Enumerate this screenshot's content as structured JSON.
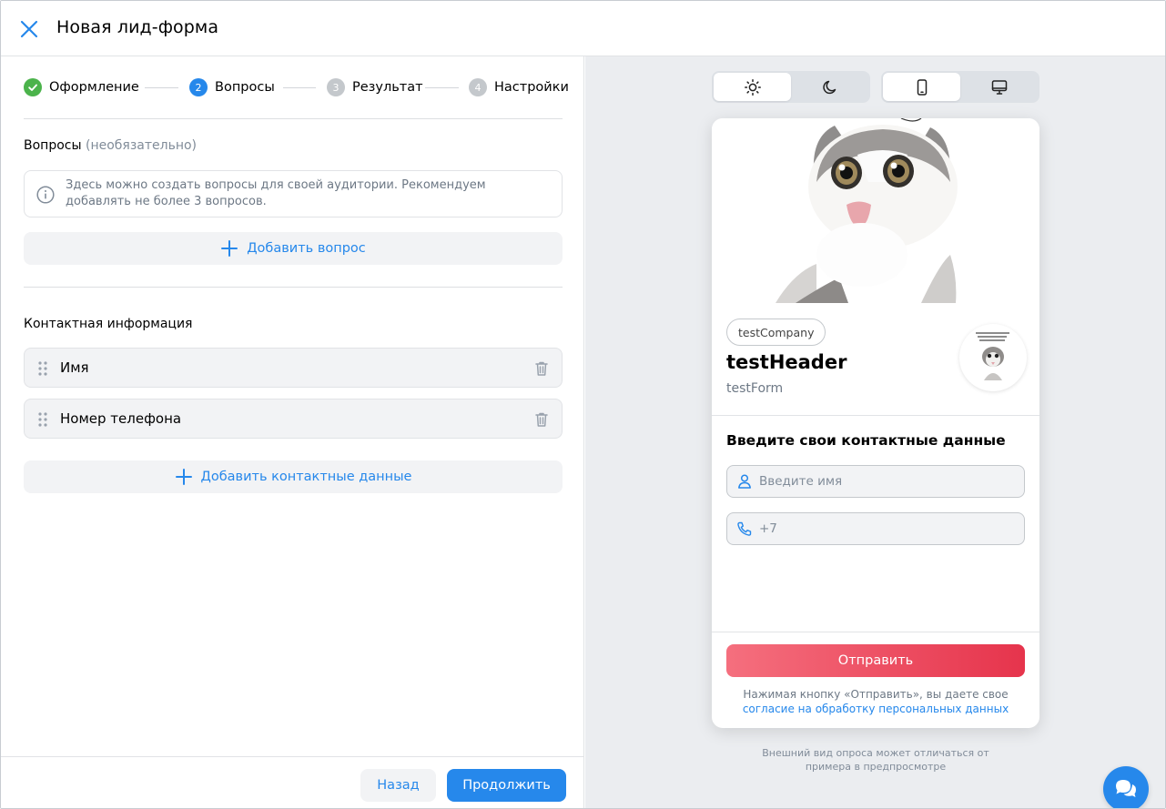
{
  "header": {
    "title": "Новая лид-форма",
    "close_icon": "close-icon"
  },
  "steps": [
    {
      "number": "1",
      "label": "Оформление",
      "state": "done"
    },
    {
      "number": "2",
      "label": "Вопросы",
      "state": "active"
    },
    {
      "number": "3",
      "label": "Результат",
      "state": "todo"
    },
    {
      "number": "4",
      "label": "Настройки",
      "state": "todo"
    }
  ],
  "questions": {
    "title": "Вопросы",
    "optional": "(необязательно)",
    "info": "Здесь можно создать вопросы для своей аудитории. Рекомендуем добавлять не более 3 вопросов.",
    "add_label": "Добавить вопрос"
  },
  "contacts": {
    "title": "Контактная информация",
    "fields": [
      {
        "label": "Имя"
      },
      {
        "label": "Номер телефона"
      }
    ],
    "add_label": "Добавить контактные данные"
  },
  "footer": {
    "back_label": "Назад",
    "next_label": "Продолжить"
  },
  "preview": {
    "theme_options": [
      "light",
      "dark"
    ],
    "theme_selected": "light",
    "device_options": [
      "mobile",
      "desktop"
    ],
    "device_selected": "mobile",
    "company": "testCompany",
    "header": "testHeader",
    "subheader": "testForm",
    "contact_title": "Введите свои контактные данные",
    "name_placeholder": "Введите имя",
    "phone_placeholder": "+7",
    "submit_label": "Отправить",
    "consent_text": "Нажимая кнопку «Отправить», вы даете свое",
    "consent_link": "согласие на обработку персональных данных",
    "note": "Внешний вид опроса может отличаться от примера в предпросмотре"
  },
  "colors": {
    "accent": "#2688eb",
    "success": "#4bb34b",
    "submit_from": "#f56f7e",
    "submit_to": "#e6344c",
    "preview_bg": "#ebedf0"
  }
}
